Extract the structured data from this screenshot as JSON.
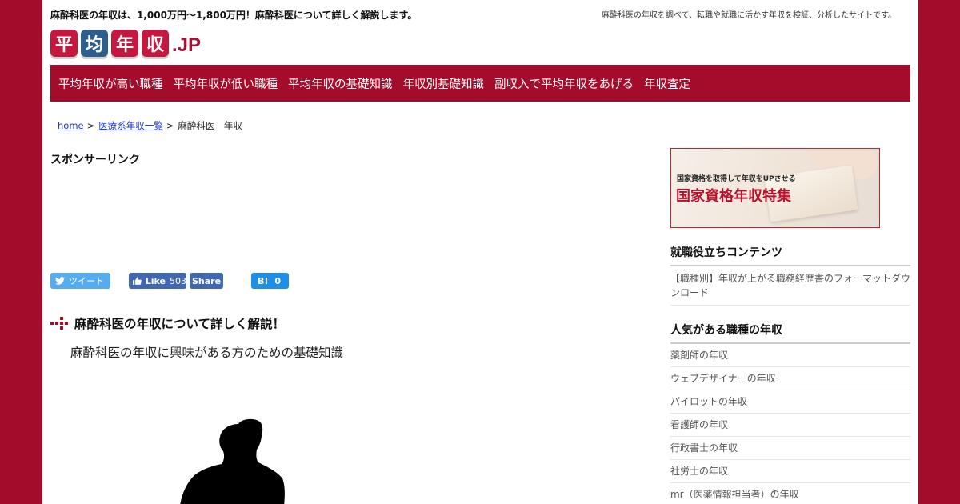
{
  "header": {
    "lead": "麻酔科医の年収は、1,000万円～1,800万円！麻酔科医について詳しく解説します。",
    "description": "麻酔科医の年収を調べて、転職や就職に活かす年収を検証、分析したサイトです。"
  },
  "logo": {
    "tiles": [
      {
        "char": "平",
        "color": "#c6183f"
      },
      {
        "char": "均",
        "color": "#2e5e8e"
      },
      {
        "char": "年",
        "color": "#c6183f"
      },
      {
        "char": "収",
        "color": "#c6183f"
      }
    ],
    "suffix": ".JP"
  },
  "nav": {
    "items": [
      "平均年収が高い職種",
      "平均年収が低い職種",
      "平均年収の基礎知識",
      "年収別基礎知識",
      "副収入で平均年収をあげる",
      "年収査定"
    ]
  },
  "breadcrumb": {
    "home": "home",
    "category": "医療系年収一覧",
    "current": "麻酔科医　年収",
    "separator": ">"
  },
  "sponsor_label": "スポンサーリンク",
  "social": {
    "tweet": "ツイート",
    "like_label": "Like",
    "like_count": "503",
    "share": "Share",
    "hatena_mark": "B!",
    "hatena_count": "0"
  },
  "article": {
    "heading": "麻酔科医の年収について詳しく解説！",
    "subheading": "麻酔科医の年収に興味がある方のための基礎知識"
  },
  "sidebar": {
    "banner": {
      "small_text": "国家資格を取得して年収をUPさせる",
      "big_text": "国家資格年収特集"
    },
    "section1": {
      "title": "就職役立ちコンテンツ",
      "links": [
        "【職種別】年収が上がる職務経歴書のフォーマットダウンロード"
      ]
    },
    "section2": {
      "title": "人気がある職種の年収",
      "links": [
        "薬剤師の年収",
        "ウェブデザイナーの年収",
        "パイロットの年収",
        "看護師の年収",
        "行政書士の年収",
        "社労士の年収",
        "mr（医薬情報担当者）の年収"
      ]
    }
  },
  "colors": {
    "brand": "#a30c2a",
    "link": "#1a33cc"
  }
}
